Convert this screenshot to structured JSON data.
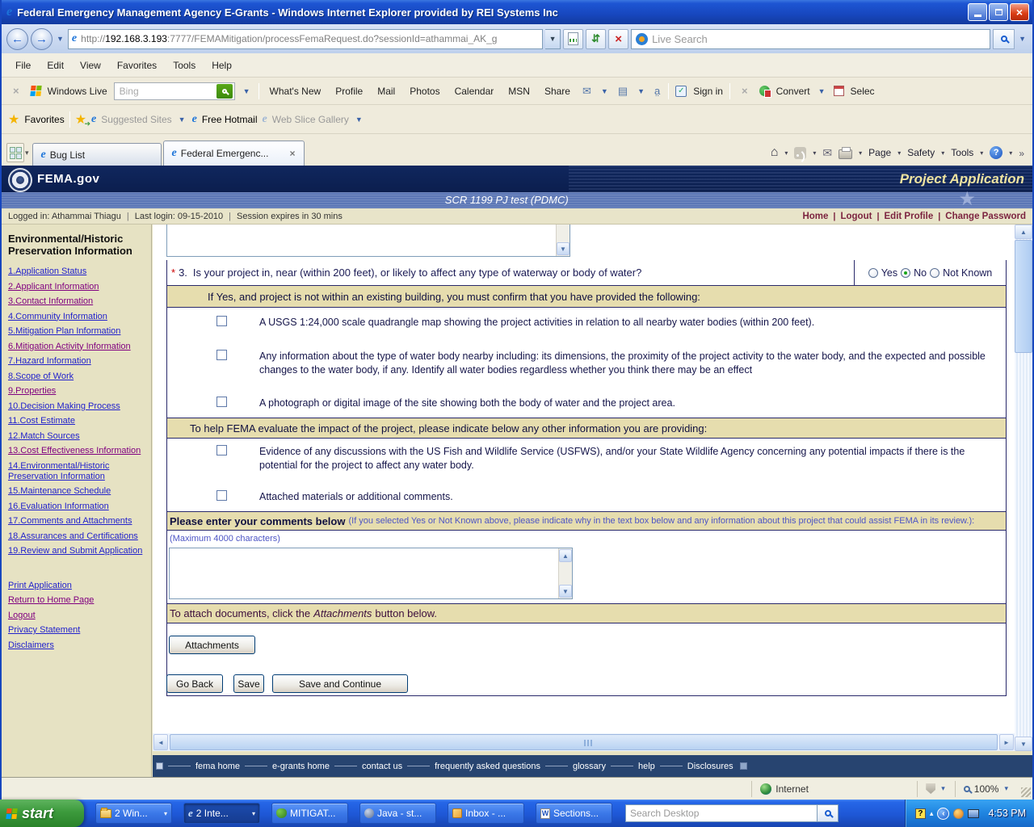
{
  "window": {
    "title": "Federal Emergency Management Agency E-Grants - Windows Internet Explorer provided by REI Systems Inc",
    "url_scheme": "http://",
    "url_host": "192.168.3.193",
    "url_rest": ":7777/FEMAMitigation/processFemaRequest.do?sessionId=athammai_AK_g",
    "live_search_placeholder": "Live Search"
  },
  "menu": {
    "items": [
      {
        "label": "File"
      },
      {
        "label": "Edit"
      },
      {
        "label": "View"
      },
      {
        "label": "Favorites"
      },
      {
        "label": "Tools"
      },
      {
        "label": "Help"
      }
    ]
  },
  "live_toolbar": {
    "brand": "Windows Live",
    "search_placeholder": "Bing",
    "links": [
      {
        "label": "What's New"
      },
      {
        "label": "Profile"
      },
      {
        "label": "Mail"
      },
      {
        "label": "Photos"
      },
      {
        "label": "Calendar"
      },
      {
        "label": "MSN"
      },
      {
        "label": "Share"
      }
    ],
    "sign_in_label": "Sign in",
    "convert_label": "Convert",
    "select_label": "Selec"
  },
  "favorites_bar": {
    "favorites_label": "Favorites",
    "suggested_sites": "Suggested Sites",
    "free_hotmail": "Free Hotmail",
    "web_slice": "Web Slice Gallery"
  },
  "tab_bar": {
    "tabs": [
      {
        "label": "Bug List"
      },
      {
        "label": "Federal Emergenc..."
      }
    ],
    "page_label": "Page",
    "safety_label": "Safety",
    "tools_label": "Tools"
  },
  "site": {
    "brand": "FEMA.gov",
    "page_title": "Project Application",
    "subtitle": "SCR 1199 PJ test (PDMC)",
    "logged_in": "Logged in: Athammai Thiagu",
    "last_login": "Last login: 09-15-2010",
    "session": "Session expires in 30 mins",
    "links": [
      {
        "label": "Home"
      },
      {
        "label": "Logout"
      },
      {
        "label": "Edit Profile"
      },
      {
        "label": "Change Password"
      }
    ]
  },
  "sidebar": {
    "title": "Environmental/Historic Preservation Information",
    "items": [
      {
        "label": "1.Application Status"
      },
      {
        "label": "2.Applicant Information"
      },
      {
        "label": "3.Contact Information"
      },
      {
        "label": "4.Community Information"
      },
      {
        "label": "5.Mitigation Plan Information"
      },
      {
        "label": "6.Mitigation Activity Information"
      },
      {
        "label": "7.Hazard Information"
      },
      {
        "label": "8.Scope of Work"
      },
      {
        "label": "9.Properties"
      },
      {
        "label": "10.Decision Making Process"
      },
      {
        "label": "11.Cost Estimate"
      },
      {
        "label": "12.Match Sources"
      },
      {
        "label": "13.Cost Effectiveness Information"
      },
      {
        "label": "14.Environmental/Historic Preservation Information"
      },
      {
        "label": "15.Maintenance Schedule"
      },
      {
        "label": "16.Evaluation Information"
      },
      {
        "label": "17.Comments and Attachments"
      },
      {
        "label": "18.Assurances and Certifications"
      },
      {
        "label": "19.Review and Submit Application"
      }
    ],
    "extra_links": [
      {
        "label": "Print Application"
      },
      {
        "label": "Return to Home Page"
      },
      {
        "label": "Logout"
      },
      {
        "label": "Privacy Statement"
      },
      {
        "label": "Disclaimers"
      }
    ]
  },
  "form": {
    "required_marker": "*",
    "question_number": "3.",
    "question_text": "Is your project in, near (within 200 feet), or likely to affect any type of waterway or body of water?",
    "options": [
      {
        "label": "Yes"
      },
      {
        "label": "No"
      },
      {
        "label": "Not Known"
      }
    ],
    "selected_option": "No",
    "confirm_header": "If Yes, and project is not within an existing building, you must confirm that you have provided the following:",
    "confirm_items": [
      {
        "label": "A USGS 1:24,000 scale quadrangle map showing the project activities in relation to all nearby water bodies (within 200 feet)."
      },
      {
        "label": "Any information about the type of water body nearby including: its dimensions, the proximity of the project activity to the water body, and the expected and possible changes to the water body, if any. Identify all water bodies regardless whether you think there may be an effect"
      },
      {
        "label": "A photograph or digital image of the site showing both the body of water and the project area."
      }
    ],
    "other_header": "To help FEMA evaluate the impact of the project, please indicate below any other information you are providing:",
    "other_items": [
      {
        "label": "Evidence of any discussions with the US Fish and Wildlife Service (USFWS), and/or your State Wildlife Agency concerning any potential impacts if there is the potential for the project to affect any water body."
      },
      {
        "label": "Attached materials or additional comments."
      }
    ],
    "comments_label": "Please enter your comments below",
    "comments_note": "(If you selected Yes or Not Known above, please indicate why in the text box below and any information about this project that could assist FEMA in its review.):",
    "comments_limit": "(Maximum 4000 characters)",
    "attach_text_1": "To attach documents, click the",
    "attach_text_italic": "Attachments",
    "attach_text_2": "button below.",
    "attachments_button": "Attachments",
    "go_back_button": "Go Back",
    "save_button": "Save",
    "save_continue_button": "Save and Continue"
  },
  "footer": {
    "links": [
      {
        "label": "fema home"
      },
      {
        "label": "e-grants home"
      },
      {
        "label": "contact us"
      },
      {
        "label": "frequently asked questions"
      },
      {
        "label": "glossary"
      },
      {
        "label": "help"
      },
      {
        "label": "Disclosures"
      }
    ]
  },
  "status_bar": {
    "zone": "Internet",
    "zoom_level": "100%"
  },
  "taskbar": {
    "start_label": "start",
    "buttons": [
      {
        "label": "2 Win..."
      },
      {
        "label": "2 Inte..."
      },
      {
        "label": "MITIGAT..."
      },
      {
        "label": "Java - st..."
      },
      {
        "label": "Inbox - ..."
      },
      {
        "label": "Sections..."
      }
    ],
    "search_placeholder": "Search Desktop",
    "time": "4:53 PM"
  },
  "icons": {
    "ie": "e",
    "back": "←",
    "forward": "→",
    "dropdown": "▼",
    "chevron": "▾",
    "refresh": "⇵",
    "stop": "×",
    "close": "×",
    "tab_close": "×",
    "x_button": "×",
    "star": "★",
    "home": "⌂",
    "mail": "✉",
    "overflow": "»",
    "left": "◄",
    "right": "►",
    "up": "▲",
    "down": "▼",
    "word": "W",
    "question": "?",
    "tray_left": "‹",
    "tray_up": "▴",
    "sign_check": "✓"
  }
}
